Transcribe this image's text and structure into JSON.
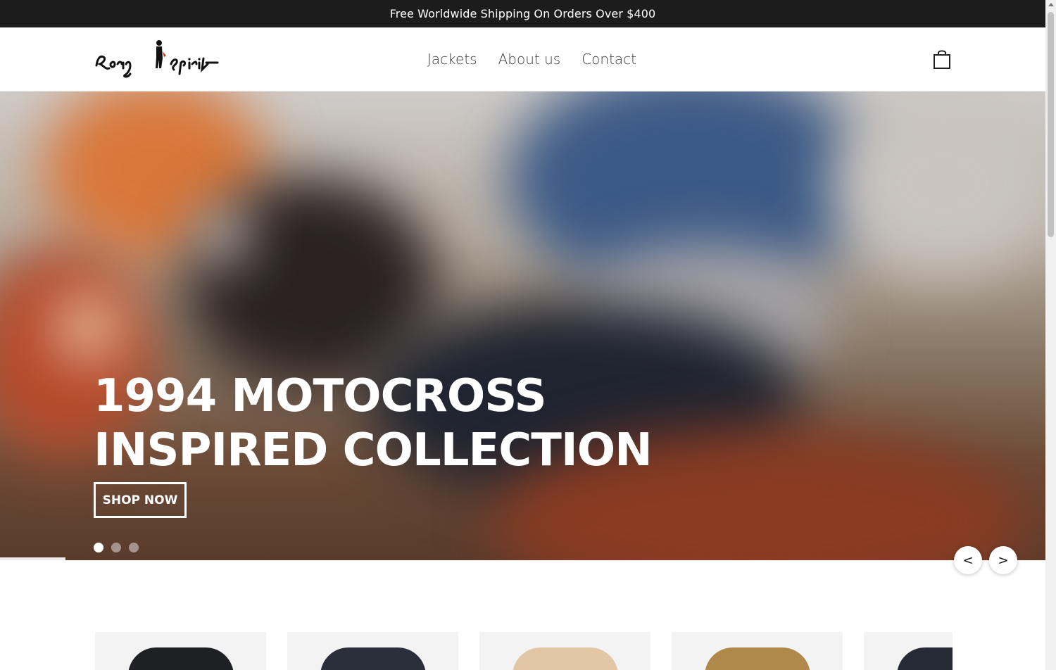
{
  "announcement": {
    "text": "Free Worldwide Shipping On Orders Over $400"
  },
  "header": {
    "logo_alt": "Racing Spirit",
    "nav": [
      {
        "label": "Jackets"
      },
      {
        "label": "About us"
      },
      {
        "label": "Contact"
      }
    ],
    "cart_icon": "shopping-bag-icon"
  },
  "hero": {
    "title_line1": "1994 MOTOCROSS",
    "title_line2": "INSPIRED COLLECTION",
    "cta_label": "SHOP NOW",
    "slide_count": 3,
    "active_slide": 1,
    "prev_label": "<",
    "next_label": ">"
  },
  "products": {
    "cards": [
      {
        "color": "#1f2024"
      },
      {
        "color": "#2b2f3b"
      },
      {
        "color": "#e3c6a6"
      },
      {
        "color": "#b08849"
      },
      {
        "color": "#252a35"
      }
    ]
  },
  "colors": {
    "announce_bg": "#1c1c1c",
    "accent": "#ffffff"
  }
}
